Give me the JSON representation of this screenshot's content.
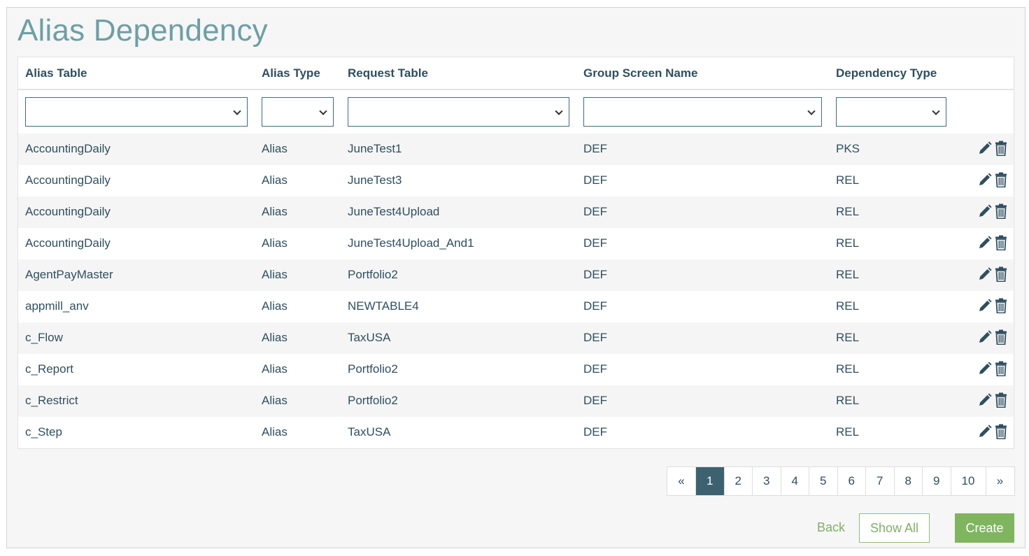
{
  "page": {
    "title": "Alias Dependency"
  },
  "table": {
    "columns": [
      "Alias Table",
      "Alias Type",
      "Request Table",
      "Group Screen Name",
      "Dependency Type"
    ],
    "rows": [
      [
        "AccountingDaily",
        "Alias",
        "JuneTest1",
        "DEF",
        "PKS"
      ],
      [
        "AccountingDaily",
        "Alias",
        "JuneTest3",
        "DEF",
        "REL"
      ],
      [
        "AccountingDaily",
        "Alias",
        "JuneTest4Upload",
        "DEF",
        "REL"
      ],
      [
        "AccountingDaily",
        "Alias",
        "JuneTest4Upload_And1",
        "DEF",
        "REL"
      ],
      [
        "AgentPayMaster",
        "Alias",
        "Portfolio2",
        "DEF",
        "REL"
      ],
      [
        "appmill_anv",
        "Alias",
        "NEWTABLE4",
        "DEF",
        "REL"
      ],
      [
        "c_Flow",
        "Alias",
        "TaxUSA",
        "DEF",
        "REL"
      ],
      [
        "c_Report",
        "Alias",
        "Portfolio2",
        "DEF",
        "REL"
      ],
      [
        "c_Restrict",
        "Alias",
        "Portfolio2",
        "DEF",
        "REL"
      ],
      [
        "c_Step",
        "Alias",
        "TaxUSA",
        "DEF",
        "REL"
      ]
    ]
  },
  "filters": {
    "alias_table": "",
    "alias_type": "",
    "request_table": "",
    "group_screen_name": "",
    "dependency_type": ""
  },
  "pagination": {
    "prev": "«",
    "pages": [
      "1",
      "2",
      "3",
      "4",
      "5",
      "6",
      "7",
      "8",
      "9",
      "10"
    ],
    "next": "»",
    "current": "1"
  },
  "buttons": {
    "back": "Back",
    "show_all": "Show All",
    "create": "Create"
  },
  "colors": {
    "title": "#6d9fa5",
    "accent": "#3c6270",
    "green": "#7fb55f"
  }
}
